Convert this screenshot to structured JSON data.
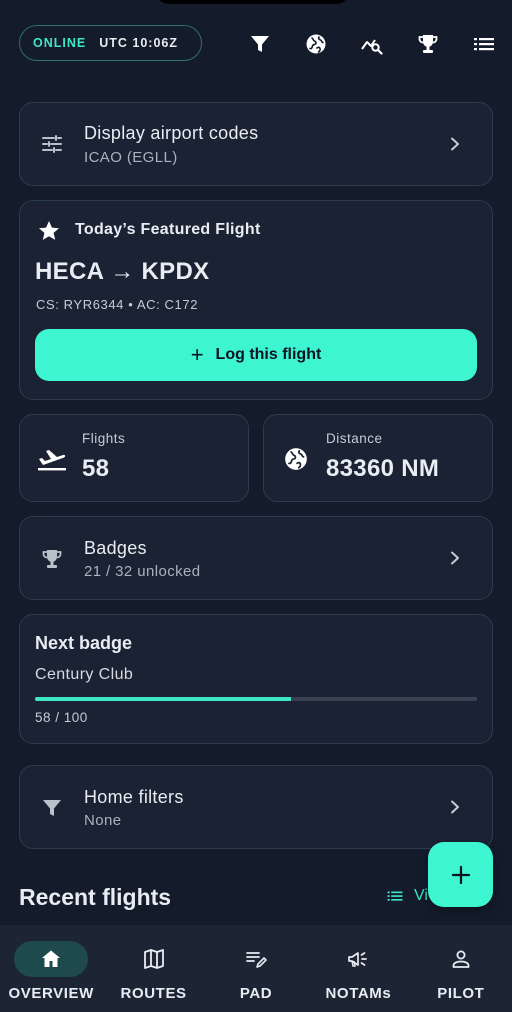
{
  "header": {
    "status_online": "ONLINE",
    "status_time": "UTC 10:06Z",
    "icons": [
      "filter-icon",
      "globe-icon",
      "chart-search-icon",
      "trophy-icon",
      "list-icon"
    ]
  },
  "airport_codes": {
    "title": "Display airport codes",
    "value": "ICAO (EGLL)"
  },
  "featured": {
    "title": "Today’s Featured Flight",
    "route": "HECA → KPDX",
    "meta": "CS: RYR6344 • AC: C172",
    "button_label": "Log this flight"
  },
  "stats": {
    "flights_label": "Flights",
    "flights_value": "58",
    "distance_label": "Distance",
    "distance_value": "83360 NM"
  },
  "badges": {
    "title": "Badges",
    "value": "21 / 32 unlocked"
  },
  "next_badge": {
    "title": "Next badge",
    "name": "Century Club",
    "progress": 0.58,
    "count": "58 / 100"
  },
  "home_filters": {
    "title": "Home filters",
    "value": "None"
  },
  "recent": {
    "title": "Recent flights",
    "view_label": "Vi"
  },
  "nav": [
    {
      "label": "OVERVIEW",
      "icon": "home-icon",
      "active": true
    },
    {
      "label": "ROUTES",
      "icon": "map-icon",
      "active": false
    },
    {
      "label": "PAD",
      "icon": "notes-edit-icon",
      "active": false
    },
    {
      "label": "NOTAMs",
      "icon": "megaphone-icon",
      "active": false
    },
    {
      "label": "PILOT",
      "icon": "person-icon",
      "active": false
    }
  ],
  "colors": {
    "background": "#141b2b",
    "card": "#1a2233",
    "accent": "#3ef5d2",
    "accent_text": "#3ee6c8"
  }
}
